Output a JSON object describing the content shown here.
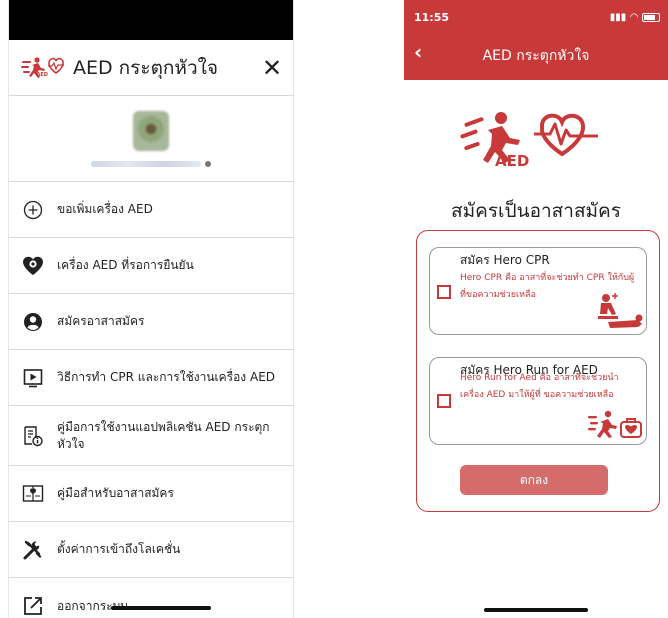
{
  "drawer": {
    "title": "AED กระตุกหัวใจ",
    "close_glyph": "✕",
    "menu": [
      {
        "icon": "plus-circle-icon",
        "label": "ขอเพิ่มเครื่อง AED"
      },
      {
        "icon": "heart-pin-icon",
        "label": "เครื่อง AED ที่รอการยืนยัน"
      },
      {
        "icon": "user-circle-icon",
        "label": "สมัครอาสาสมัคร"
      },
      {
        "icon": "video-play-icon",
        "label": "วิธีการทำ CPR และการใช้งานเครื่อง AED"
      },
      {
        "icon": "manual-info-icon",
        "label": "คู่มือการใช้งานแอปพลิเคชัน AED กระตุกหัวใจ"
      },
      {
        "icon": "volunteer-book-icon",
        "label": "คู่มือสำหรับอาสาสมัคร"
      },
      {
        "icon": "tools-icon",
        "label": "ตั้งค่าการเข้าถึงโลเคชั่น"
      },
      {
        "icon": "logout-icon",
        "label": "ออกจากระบบ"
      }
    ]
  },
  "screen": {
    "status_time": "11:55",
    "nav_back": "‹",
    "nav_title": "AED กระตุกหัวใจ",
    "logo_text": "AED",
    "heading": "สมัครเป็นอาสาสมัคร",
    "options": [
      {
        "title": "สมัคร Hero CPR",
        "description": "Hero CPR คือ อาสาที่จะช่วยทำ CPR ให้กับผู้ที่ขอความช่วยเหลือ",
        "icon": "cpr-icon",
        "checked": false
      },
      {
        "title": "สมัคร Hero Run for AED",
        "description": "Hero Run for Aed คือ อาสาที่จะช่วยนำเครื่อง AED มาให้ผู้ที่ ขอความช่วยเหลือ",
        "icon": "runner-aed-icon",
        "checked": false
      }
    ],
    "ok_button": "ตกลง"
  },
  "colors": {
    "brand_red": "#c8393a",
    "button_red": "#d36c6b"
  }
}
